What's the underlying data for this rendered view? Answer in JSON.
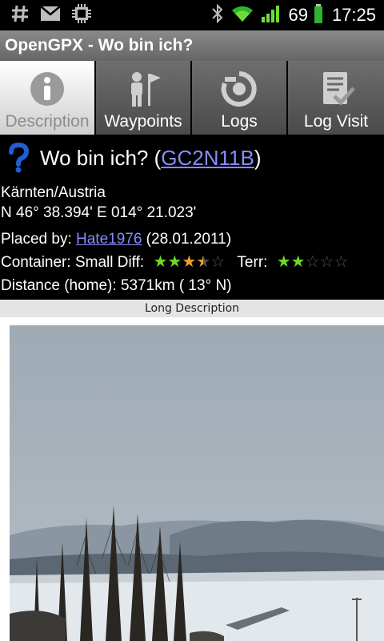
{
  "status_bar": {
    "left_icons": [
      "hash-icon",
      "mail-icon",
      "chip-icon"
    ],
    "battery_percent": "69",
    "time": "17:25",
    "accent_color": "#2fb32f"
  },
  "app": {
    "title": "OpenGPX - Wo bin ich?"
  },
  "tabs": [
    {
      "label": "Description",
      "icon": "info-icon",
      "active": true
    },
    {
      "label": "Waypoints",
      "icon": "person-flag-icon",
      "active": false
    },
    {
      "label": "Logs",
      "icon": "logs-icon",
      "active": false
    },
    {
      "label": "Log Visit",
      "icon": "log-visit-icon",
      "active": false
    }
  ],
  "cache": {
    "name_prefix": "Wo bin ich? (",
    "code": "GC2N11B",
    "name_suffix": ")",
    "region": "Kärnten/Austria",
    "coords": "N 46° 38.394' E 014° 21.023'",
    "placed_by_label": "Placed by: ",
    "owner": "Hate1976",
    "placed_date": " (28.01.2011)",
    "container_label": "Container: Small Diff:",
    "difficulty": 3.5,
    "terrain_label": "Terr:",
    "terrain": 2,
    "distance_label": "Distance (home):",
    "distance_value": "5371km ( 13° N)"
  },
  "long_description": {
    "header": "Long Description"
  },
  "colors": {
    "link": "#8a8aff",
    "star_green": "#6fd92a",
    "star_orange": "#f0a030",
    "star_empty": "#555555"
  }
}
